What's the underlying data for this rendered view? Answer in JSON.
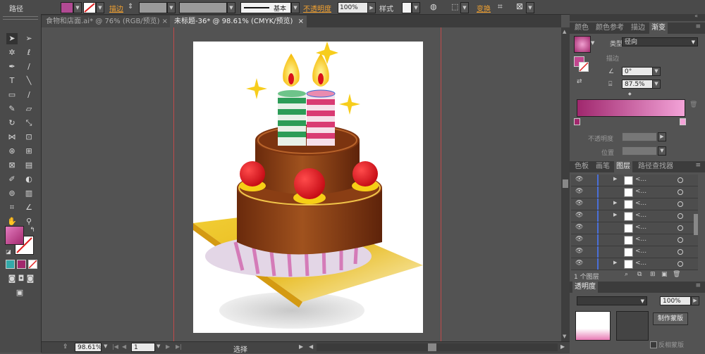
{
  "control_bar": {
    "path_label": "路径",
    "stroke_label": "描边",
    "stroke_style": "基本",
    "opacity_label": "不透明度",
    "opacity_value": "100%",
    "style_label": "样式",
    "transform_label": "变换"
  },
  "tabs": [
    {
      "label": "食物和店面.ai* @ 76% (RGB/预览)",
      "active": false
    },
    {
      "label": "未标题-36* @ 98.61% (CMYK/预览)",
      "active": true
    }
  ],
  "color_panel": {
    "tabs": [
      "颜色",
      "颜色参考",
      "描边",
      "渐变"
    ],
    "active_tab": "渐变",
    "type_label": "类型",
    "type_value": "径向",
    "stroke_label": "描边",
    "angle_value": "0°",
    "ratio_value": "87.5%",
    "opacity_label": "不透明度",
    "position_label": "位置",
    "gradient_start": "#a0286e",
    "gradient_end": "#f3a3d8"
  },
  "layers_panel": {
    "tabs": [
      "色板",
      "画笔",
      "图层",
      "路径查找器"
    ],
    "active_tab": "图层",
    "rows": [
      {
        "name": "<...",
        "expand": true
      },
      {
        "name": "<...",
        "expand": false
      },
      {
        "name": "<...",
        "expand": true
      },
      {
        "name": "<...",
        "expand": true
      },
      {
        "name": "<...",
        "expand": false
      },
      {
        "name": "<...",
        "expand": false
      },
      {
        "name": "<...",
        "expand": false
      },
      {
        "name": "<...",
        "expand": true
      }
    ],
    "layer_count": "1 个图层"
  },
  "transparency_panel": {
    "title": "透明度",
    "opacity_value": "100%",
    "make_mask_button": "制作蒙版",
    "invert_mask_label": "反相蒙版"
  },
  "status_bar": {
    "zoom": "98.61%",
    "artboard_num": "1",
    "mode": "选择"
  }
}
